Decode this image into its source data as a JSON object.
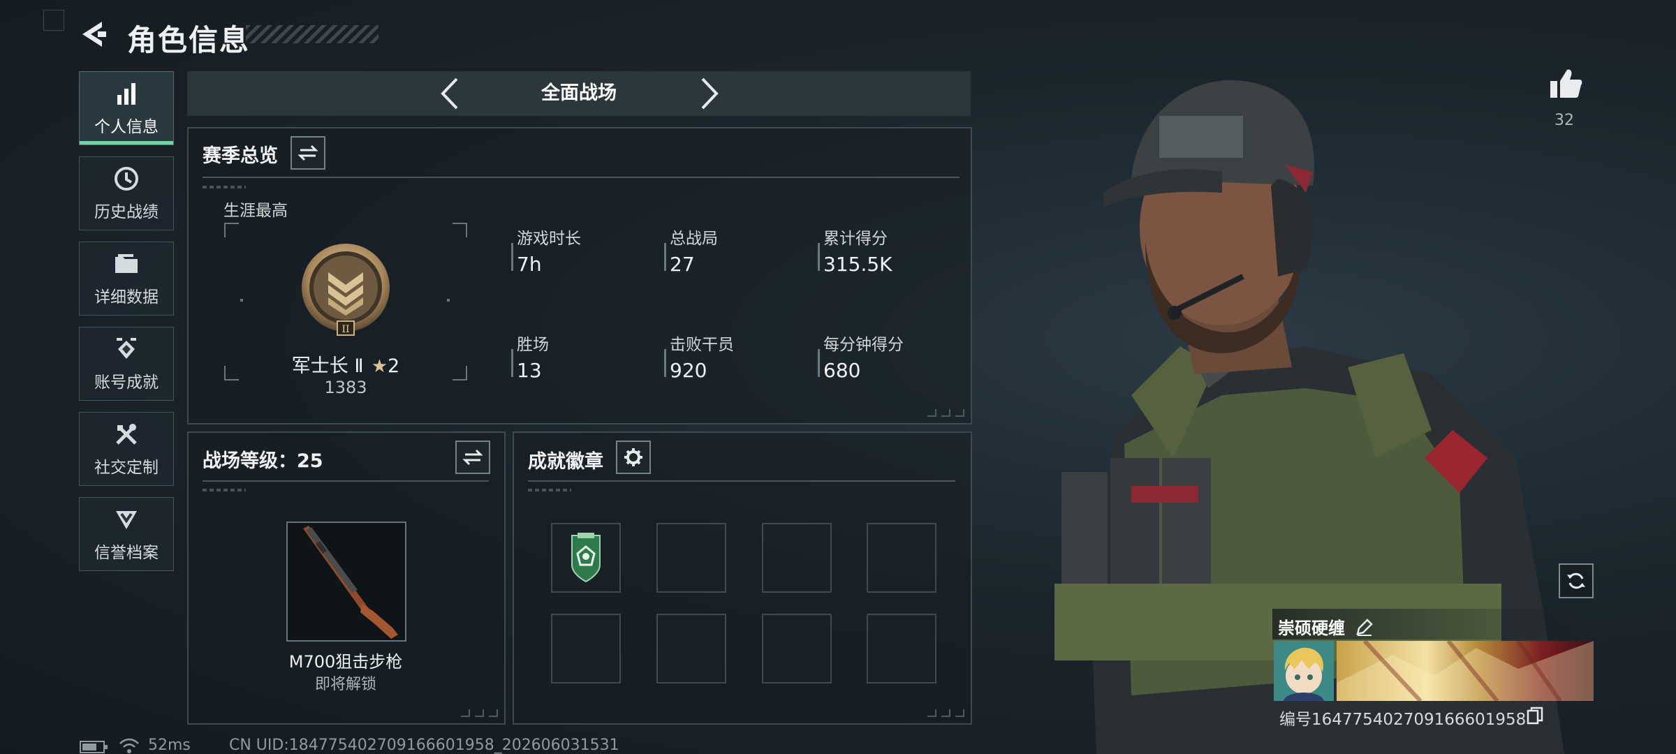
{
  "header": {
    "title": "角色信息"
  },
  "sidebar": {
    "items": [
      {
        "label": "个人信息",
        "icon": "bar-chart-icon",
        "active": true
      },
      {
        "label": "历史战绩",
        "icon": "history-icon"
      },
      {
        "label": "详细数据",
        "icon": "folder-icon"
      },
      {
        "label": "账号成就",
        "icon": "achievement-icon"
      },
      {
        "label": "社交定制",
        "icon": "tools-icon"
      },
      {
        "label": "信誉档案",
        "icon": "shield-down-icon"
      }
    ]
  },
  "mode": {
    "label": "全面战场"
  },
  "season": {
    "title": "赛季总览",
    "career_label": "生涯最高",
    "rank_name": "军士长 Ⅱ",
    "rank_stars": "2",
    "rank_score": "1383",
    "stats": [
      {
        "label": "游戏时长",
        "value": "7h"
      },
      {
        "label": "总战局",
        "value": "27"
      },
      {
        "label": "累计得分",
        "value": "315.5K"
      },
      {
        "label": "胜场",
        "value": "13"
      },
      {
        "label": "击败干员",
        "value": "920"
      },
      {
        "label": "每分钟得分",
        "value": "680"
      }
    ]
  },
  "battle_level": {
    "title": "战场等级：25",
    "weapon_name": "M700狙击步枪",
    "weapon_status": "即将解锁"
  },
  "badges": {
    "title": "成就徽章",
    "slots_filled": 1,
    "slots_total": 8
  },
  "profile": {
    "like_count": "32",
    "name": "崇硕硬缠",
    "id_text": "编号1647754027091666019​58"
  },
  "status_bar": {
    "ping": "52ms",
    "uid": "CN UID:18477540270916660195​8_202606031531"
  },
  "colors": {
    "accent": "#6fd6a2",
    "background": "#1b252c",
    "panel_border": "#3d4a51"
  }
}
